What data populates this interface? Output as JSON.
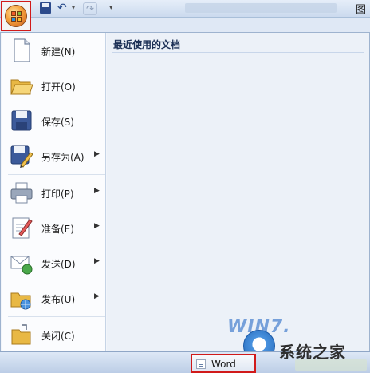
{
  "quick_access": {
    "save_icon": "save-icon",
    "undo_icon": "undo-icon",
    "redo_icon": "redo-icon",
    "customize_glyph": "▾",
    "corner_text": "图"
  },
  "menu": {
    "items": [
      {
        "label": "新建(N)",
        "icon": "new-document-icon",
        "submenu": false
      },
      {
        "label": "打开(O)",
        "icon": "open-folder-icon",
        "submenu": false
      },
      {
        "label": "保存(S)",
        "icon": "save-disk-icon",
        "submenu": false
      },
      {
        "label": "另存为(A)",
        "icon": "save-as-icon",
        "submenu": true
      },
      {
        "label": "打印(P)",
        "icon": "print-icon",
        "submenu": true
      },
      {
        "label": "准备(E)",
        "icon": "prepare-icon",
        "submenu": true
      },
      {
        "label": "发送(D)",
        "icon": "send-icon",
        "submenu": true
      },
      {
        "label": "发布(U)",
        "icon": "publish-icon",
        "submenu": true
      },
      {
        "label": "关闭(C)",
        "icon": "close-folder-icon",
        "submenu": false
      }
    ],
    "arrow_glyph": "▶"
  },
  "recent": {
    "title": "最近使用的文档"
  },
  "watermark": {
    "brand": "WIN7.",
    "text": "系统之家"
  },
  "taskbar": {
    "word_button_label": "Word"
  },
  "colors": {
    "highlight_border": "#d11a1a",
    "menu_background": "#f2f5fa"
  }
}
